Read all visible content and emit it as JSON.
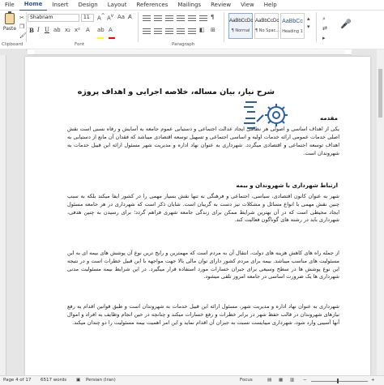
{
  "ribbon": {
    "tabs": [
      "File",
      "Home",
      "Insert",
      "Design",
      "Layout",
      "References",
      "Mailings",
      "Review",
      "View",
      "Help"
    ],
    "active_tab": "Home",
    "clipboard": {
      "paste_label": "Paste",
      "group_label": "Clipboard"
    },
    "font": {
      "name": "Shabnam",
      "size": "11",
      "group_label": "Font",
      "bold": "B",
      "italic": "I",
      "underline": "U"
    },
    "paragraph": {
      "group_label": "Paragraph"
    },
    "styles": [
      {
        "sample": "AaBbCcDc",
        "name": "¶ Normal"
      },
      {
        "sample": "AaBbCcDc",
        "name": "¶ No Spac..."
      },
      {
        "sample": "AaBbCc",
        "name": "Heading 1"
      }
    ],
    "colors": {
      "accent": "#2b579a",
      "highlight": "#ffff00",
      "font_color": "#ff0000"
    }
  },
  "document": {
    "title": "شرح نیاز، بیان مساله، خلاصه اجرایی و اهداف پروژه",
    "intro_heading": "مقدمه",
    "intro": "یکی از اهداف اساسی و اصولی هر نظامی ایجاد عدالت اجتماعی و دستیابی عموم جامعه به آسایش و رفاه نسبی است نقش اصلی خدمات عمومی ارائه خدمات اولیه و اساسی اجتماعی و تسهیل توسعه اقتصادی میباشد که فقدان آن مانع از دستیابی به اهداف توسعه اجتماعی و اقتصادی میگردد. شهرداری به عنوان نهاد اداره و مدیریت شهر مسئول ارائه این قبیل خدمات به شهروندان است.",
    "section_heading": "ارتباط شهرداری با شهروندان و بیمه",
    "section_p1": "شهر به عنوان کانون اقتصادی، سیاسی، اجتماعی و فرهنگی نه تنها نقش بسیار مهمی را در کشور ایفا میکند بلکه به سبب چنین نقش مهمی با انواع مسائل و مشکلات نیز دست به گریبان است. شایان ذکر است که شهرداری در هر جامعه مسئول ایجاد محیطی است که در آن بهترین شرایط ممکن برای زندگی جامعه شهری فراهم گردد؛ برای رسیدن به چنین هدفی، شهرداری باید در رشته های گوناگون فعالیت کند.",
    "section_p2": "از جمله راه های کاهش هزینه های دولت، انتقال آن به مردم است که مهمترین و رایج ترین نوع آن پوشش های بیمه ای به این مسئولیت های مناسب میباشد. بیمه برای مردم کشور دارای توان مالی بالا جهت مواجهه با این قبیل خطرات است و در نتیجه این نوع پوشش ها در سطح وسیعی برای جبران خسارات مورد استفاده قرار میگیرد. در این شرایط بیمه مسئولیت مدنی شهرداری ها یک ضرورت اساسی در جامعه امروز تلقی میشود.",
    "section_p3": "شهرداری به عنوان نهاد اداره و مدیریت شهر، مسئول ارائه این قبیل خدمات به شهروندان است و طبق قوانین اقدام به رفع نیازهای شهروندان در قالب حفظ شهر در برابر خطرات و رفع خسارات میکند و چنانچه در حین انجام وظایف به افراد و اموال آنها آسیبی وارد شود، شهرداری میبایست نسبت به جبران آن اقدام نماید و این امر اهمیت بیمه مسئولیت را دو چندان میکند."
  },
  "status": {
    "page": "Page 4 of 17",
    "words": "6517 words",
    "language": "Persian (Iran)",
    "focus": "Focus"
  }
}
